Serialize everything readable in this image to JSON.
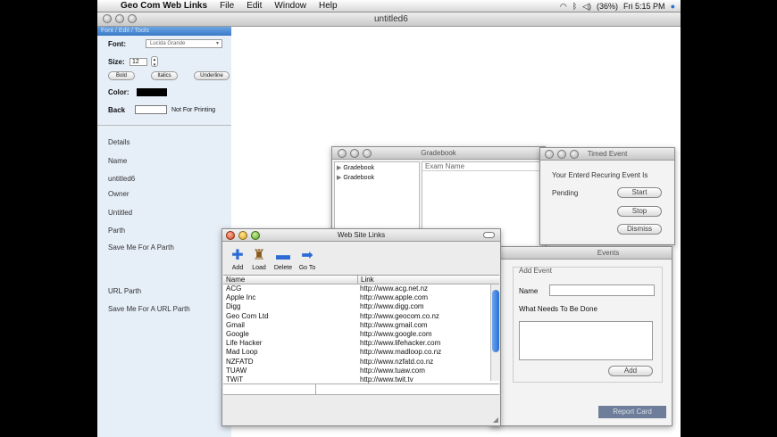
{
  "menubar": {
    "app": "Geo Com Web Links",
    "items": [
      "File",
      "Edit",
      "Window",
      "Help"
    ],
    "battery": "(36%)",
    "clock": "Fri 5:15 PM"
  },
  "document": {
    "title": "untitled6"
  },
  "font_panel": {
    "title": "Font / Edit / Tools",
    "font_label": "Font:",
    "font_value": "Lucida Grande",
    "size_label": "Size:",
    "size_value": "12",
    "bold": "Bold",
    "italics": "Italics",
    "underline": "Underline",
    "color_label": "Color:",
    "back_label": "Back",
    "not_for_printing": "Not For Printing"
  },
  "details": {
    "heading": "Details",
    "name_label": "Name",
    "name_value": "untitled6",
    "owner_label": "Owner",
    "owner_value": "Untitled",
    "path_label": "Parth",
    "path_value": "Save Me For A Parth",
    "url_label": "URL Parth",
    "url_value": "Save Me For A URL Parth"
  },
  "gradebook": {
    "title": "Gradebook",
    "items": [
      "Gradebook",
      "Gradebook"
    ],
    "column": "Exam Name"
  },
  "timed_event": {
    "title": "Timed Event",
    "message": "Your Enterd Recuring Event Is",
    "status": "Pending",
    "start": "Start",
    "stop": "Stop",
    "dismiss": "Dismiss"
  },
  "events": {
    "title": "Events",
    "section": "Add Event",
    "name_label": "Name",
    "needs_label": "What Needs To Be Done",
    "add": "Add",
    "report": "Report Card"
  },
  "weblinks": {
    "title": "Web Site Links",
    "toolbar": [
      "Add",
      "Load",
      "Delete",
      "Go To"
    ],
    "columns": [
      "Name",
      "Link"
    ],
    "rows": [
      {
        "name": "ACG",
        "link": "http://www.acg.net.nz"
      },
      {
        "name": "Apple Inc",
        "link": "http://www.apple.com"
      },
      {
        "name": "Digg",
        "link": "http://www.digg.com"
      },
      {
        "name": "Geo Com Ltd",
        "link": "http://www.geocom.co.nz"
      },
      {
        "name": "Gmail",
        "link": "http://www.gmail.com"
      },
      {
        "name": "Google",
        "link": "http://www.google.com"
      },
      {
        "name": "Life Hacker",
        "link": "http://www.lifehacker.com"
      },
      {
        "name": "Mad Loop",
        "link": "http://www.madloop.co.nz"
      },
      {
        "name": "NZFATD",
        "link": "http://www.nzfatd.co.nz"
      },
      {
        "name": "TUAW",
        "link": "http://www.tuaw.com"
      },
      {
        "name": "TWiT",
        "link": "http://www.twit.tv"
      }
    ]
  },
  "colors": {
    "accent": "#3a7ac9",
    "panel": "#e6eef8"
  }
}
